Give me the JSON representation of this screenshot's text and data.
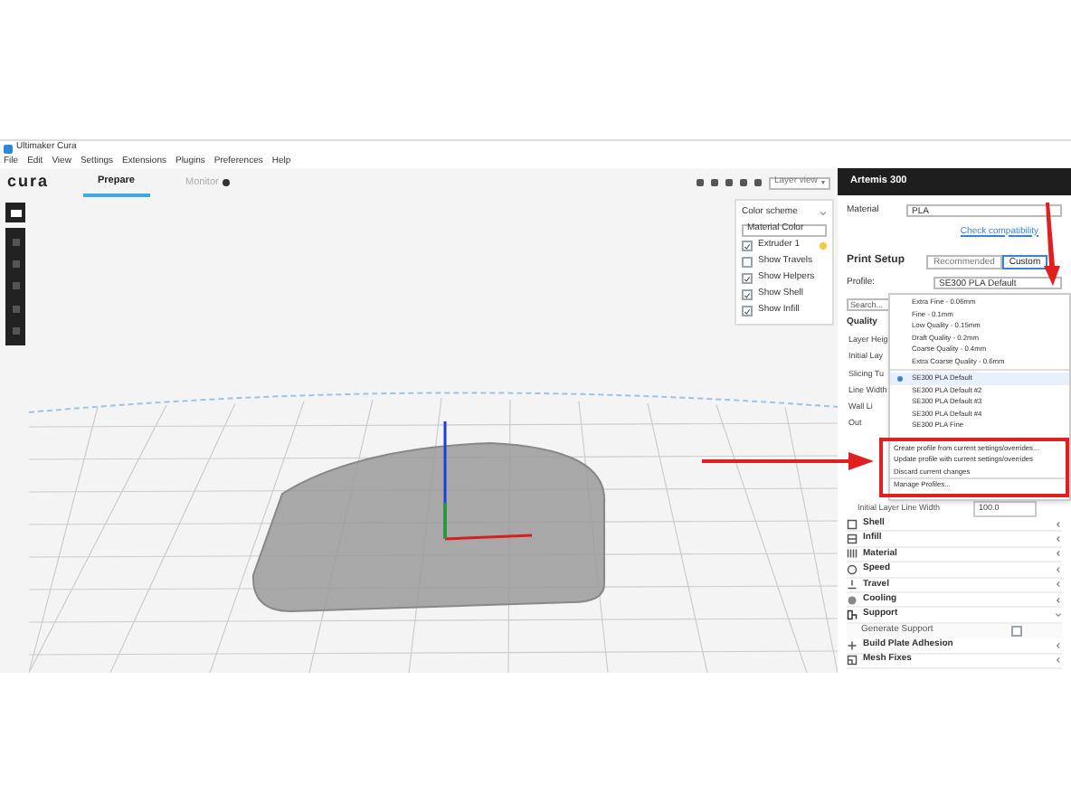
{
  "window": {
    "title": "Ultimaker Cura"
  },
  "menu": [
    "File",
    "Edit",
    "View",
    "Settings",
    "Extensions",
    "Plugins",
    "Preferences",
    "Help"
  ],
  "logo": "cura",
  "tabs": [
    {
      "label": "Prepare",
      "selected": true
    },
    {
      "label": "Monitor",
      "selected": false
    }
  ],
  "view_mode": "Layer view",
  "view_panel": {
    "color_scheme_label": "Color scheme",
    "color_scheme": "Material Color",
    "options": [
      {
        "label": "Extruder 1",
        "checked": true,
        "kind": "extruder"
      },
      {
        "label": "Show Travels",
        "checked": false,
        "kind": "plain"
      },
      {
        "label": "Show Helpers",
        "checked": true,
        "kind": "plain"
      },
      {
        "label": "Show Shell",
        "checked": true,
        "kind": "plain"
      },
      {
        "label": "Show Infill",
        "checked": true,
        "kind": "plain"
      }
    ]
  },
  "printer": {
    "name": "Artemis 300"
  },
  "material": {
    "label": "Material",
    "value": "PLA"
  },
  "check_compatibility": "Check compatibility",
  "print_setup": {
    "title": "Print Setup",
    "modes": [
      {
        "label": "Recommended",
        "selected": false
      },
      {
        "label": "Custom",
        "selected": true
      }
    ]
  },
  "profile": {
    "label": "Profile:",
    "value": "SE300 PLA Default"
  },
  "search": {
    "placeholder": "Search..."
  },
  "quality_header": "Quality",
  "quality_rows": [
    "Layer Heig",
    "Initial Lay",
    "Slicing Tu",
    "Line Width",
    "Wall Li",
    "Out"
  ],
  "initial_layer_line_width": {
    "label": "Initial Layer Line Width",
    "value": "100.0"
  },
  "profile_menu": {
    "qualities": [
      {
        "label": "Extra Fine - 0.06mm",
        "selected": false
      },
      {
        "label": "Fine - 0.1mm",
        "selected": false
      },
      {
        "label": "Low Quality - 0.15mm",
        "selected": false
      },
      {
        "label": "Draft Quality - 0.2mm",
        "selected": false
      },
      {
        "label": "Coarse Quality - 0.4mm",
        "selected": false
      },
      {
        "label": "Extra Coarse Quality - 0.6mm",
        "selected": false
      }
    ],
    "profiles": [
      {
        "label": "SE300 PLA Default",
        "selected": true
      },
      {
        "label": "SE300 PLA Default #2",
        "selected": false
      },
      {
        "label": "SE300 PLA Default #3",
        "selected": false
      },
      {
        "label": "SE300 PLA Default #4",
        "selected": false
      },
      {
        "label": "SE300 PLA Fine",
        "selected": false
      }
    ],
    "actions": [
      "Create profile from current settings/overrides...",
      "Update profile with current settings/overrides",
      "Discard current changes"
    ],
    "manage": "Manage Profiles..."
  },
  "categories": [
    {
      "label": "Shell",
      "expanded": false,
      "kind": "shell"
    },
    {
      "label": "Infill",
      "expanded": false,
      "kind": "infill"
    },
    {
      "label": "Material",
      "expanded": false,
      "kind": "material"
    },
    {
      "label": "Speed",
      "expanded": false,
      "kind": "speed"
    },
    {
      "label": "Travel",
      "expanded": false,
      "kind": "travel"
    },
    {
      "label": "Cooling",
      "expanded": false,
      "kind": "cooling"
    },
    {
      "label": "Support",
      "expanded": true,
      "kind": "support",
      "children": [
        {
          "label": "Generate Support",
          "checked": false
        }
      ]
    },
    {
      "label": "Build Plate Adhesion",
      "expanded": false,
      "kind": "adhesion"
    },
    {
      "label": "Mesh Fixes",
      "expanded": false,
      "kind": "mesh"
    }
  ]
}
